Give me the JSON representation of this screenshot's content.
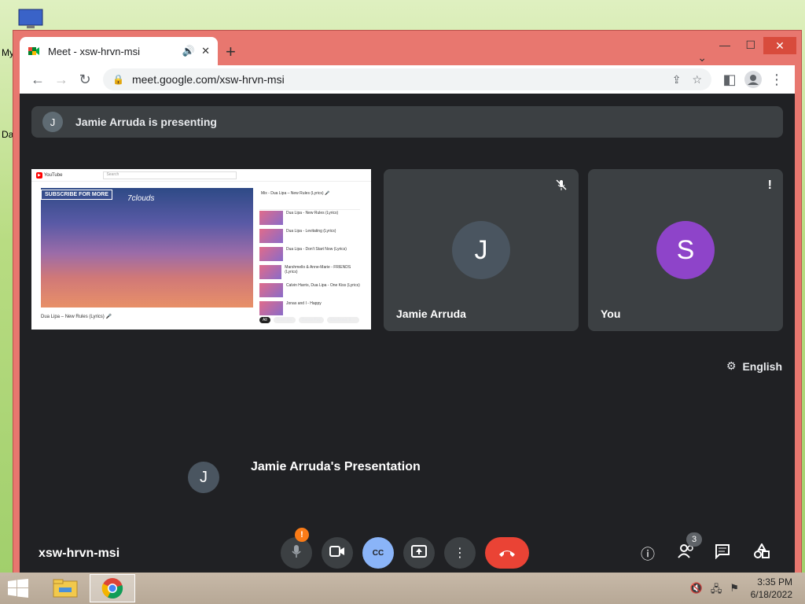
{
  "desktop": {
    "label_1": "My",
    "label_2": "Da"
  },
  "browser": {
    "tab": {
      "title": "Meet - xsw-hrvn-msi",
      "audio_icon": "speaker-icon",
      "close_label": "✕"
    },
    "new_tab_label": "+",
    "address": "meet.google.com/xsw-hrvn-msi",
    "window_controls": {
      "minimize": "—",
      "maximize": "☐",
      "close": "✕"
    }
  },
  "meet": {
    "presenting_banner": {
      "avatar": "J",
      "text": "Jamie Arruda is presenting"
    },
    "shared_screen": {
      "logo": "YouTube",
      "search_placeholder": "Search",
      "subscribe": "SUBSCRIBE FOR MORE",
      "brand": "7clouds",
      "video_title": "Dua Lipa – New Rules (Lyrics) 🎤",
      "playlist_title": "Mix - Dua Lipa – New Rules (Lyrics) 🎤",
      "playlist": [
        "Dua Lipa - New Rules (Lyrics)",
        "Dua Lipa - Levitating (Lyrics)",
        "Dua Lipa - Don't Start Now (Lyrics)",
        "Marshmello & Anne-Marie - FRIENDS (Lyrics)",
        "Calvin Harris, Dua Lipa - One Kiss (Lyrics)",
        "Jonas and I - Happy"
      ],
      "chips": [
        "All",
        "Dua Lipa",
        "Dance Pop",
        "Electronic & ..."
      ]
    },
    "tiles": [
      {
        "initial": "J",
        "name": "Jamie Arruda",
        "color": "#4a5560",
        "status_icon": "mic-off-icon",
        "status": "🎙̸"
      },
      {
        "initial": "S",
        "name": "You",
        "color": "#8e44c9",
        "status_icon": "alert-icon",
        "status": "!"
      }
    ],
    "language": {
      "icon": "gear-icon",
      "label": "English"
    },
    "presentation": {
      "avatar": "J",
      "label": "Jamie Arruda's Presentation"
    },
    "meeting_code": "xsw-hrvn-msi",
    "controls": {
      "mic_warning": "!",
      "cc_label": "CC",
      "participants_count": "3"
    },
    "colors": {
      "end_call": "#ea4335",
      "cc_active": "#8ab4f8",
      "tab_bar": "#e8776f"
    }
  },
  "taskbar": {
    "time": "3:35 PM",
    "date": "6/18/2022"
  }
}
